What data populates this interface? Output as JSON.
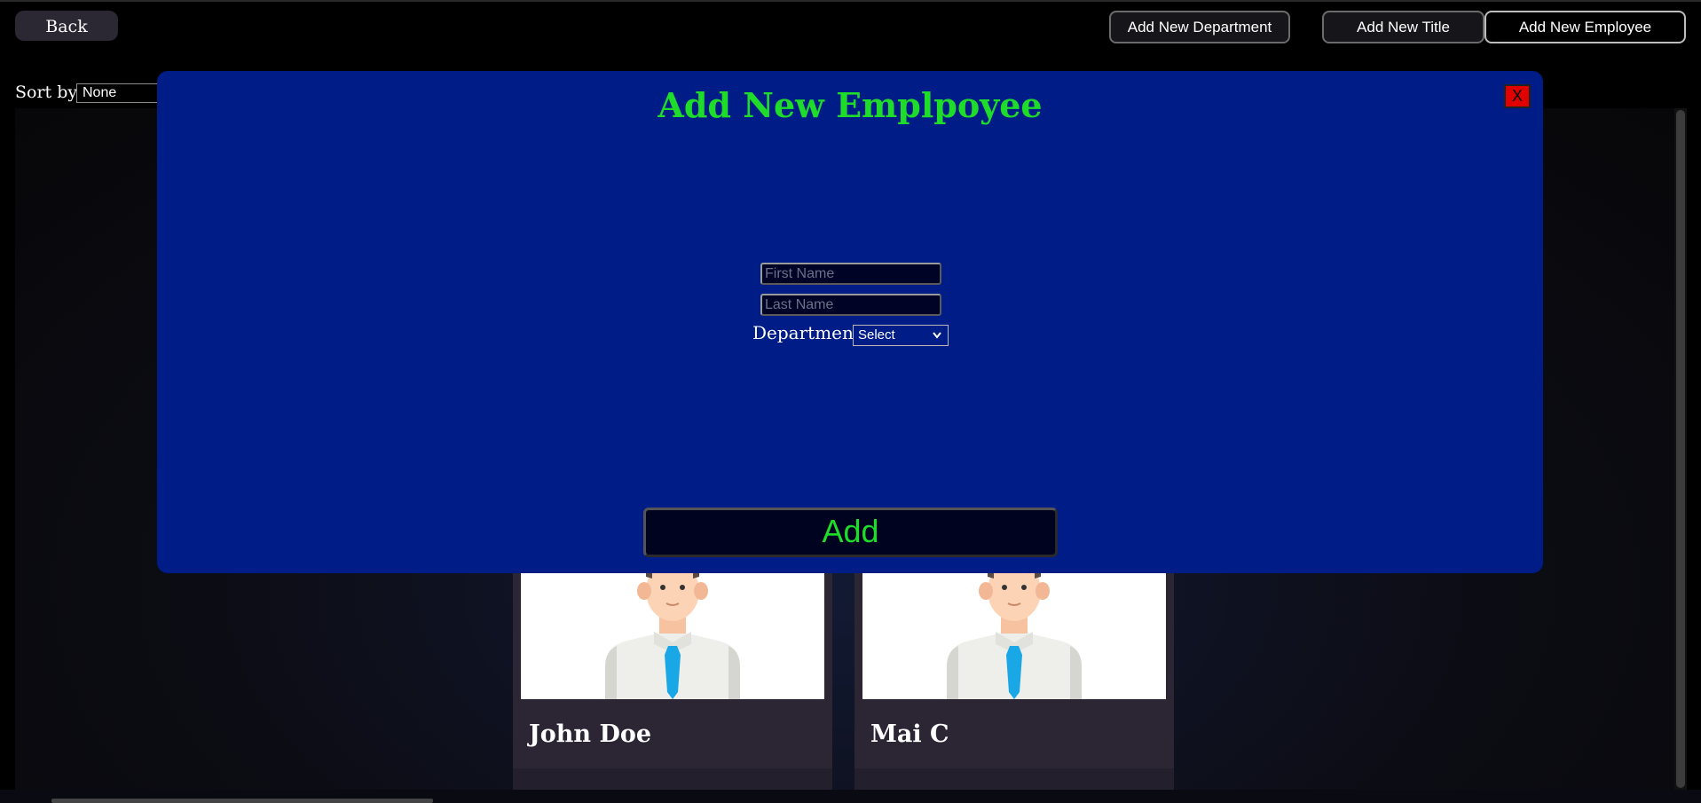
{
  "header": {
    "back_label": "Back",
    "buttons": [
      {
        "label": "Add New Department",
        "active": false
      },
      {
        "label": "Add New Title",
        "active": false
      },
      {
        "label": "Add New Employee",
        "active": true
      }
    ]
  },
  "sort": {
    "label": "Sort by:",
    "value": "None"
  },
  "employees": [
    {
      "name": "John Doe",
      "avatar_icon": "employee-avatar-icon"
    },
    {
      "name": "Mai C",
      "avatar_icon": "employee-avatar-icon"
    }
  ],
  "modal": {
    "title": "Add New Emplpoyee",
    "close_label": "X",
    "first_name_placeholder": "First Name",
    "last_name_placeholder": "Last Name",
    "department_label": "Department",
    "department_value": "Select",
    "submit_label": "Add"
  },
  "colors": {
    "modal_background": "#001c87",
    "accent_green": "#1fdc2a",
    "close_red": "#e00000"
  }
}
